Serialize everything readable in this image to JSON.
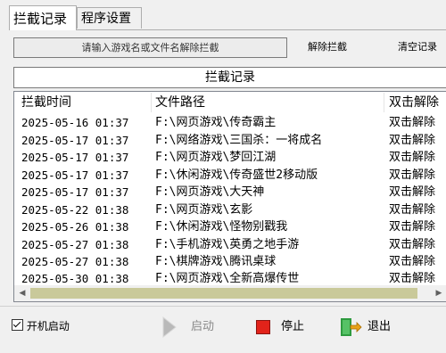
{
  "tabs": [
    {
      "label": "拦截记录",
      "active": true
    },
    {
      "label": "程序设置",
      "active": false
    }
  ],
  "search": {
    "placeholder": "请输入游戏名或文件名解除拦截"
  },
  "actions": {
    "unblock": "解除拦截",
    "clear": "清空记录"
  },
  "section_title": "拦截记录",
  "table": {
    "columns": [
      "拦截时间",
      "文件路径",
      "双击解除"
    ],
    "rows": [
      {
        "time": "2025-05-16 01:37",
        "path": "F:\\网页游戏\\传奇霸主",
        "action": "双击解除"
      },
      {
        "time": "2025-05-17 01:37",
        "path": "F:\\网络游戏\\三国杀：一将成名",
        "action": "双击解除"
      },
      {
        "time": "2025-05-17 01:37",
        "path": "F:\\网页游戏\\梦回江湖",
        "action": "双击解除"
      },
      {
        "time": "2025-05-17 01:37",
        "path": "F:\\休闲游戏\\传奇盛世2移动版",
        "action": "双击解除"
      },
      {
        "time": "2025-05-17 01:37",
        "path": "F:\\网页游戏\\大天神",
        "action": "双击解除"
      },
      {
        "time": "2025-05-22 01:38",
        "path": "F:\\网页游戏\\玄影",
        "action": "双击解除"
      },
      {
        "time": "2025-05-26 01:38",
        "path": "F:\\休闲游戏\\怪物别戳我",
        "action": "双击解除"
      },
      {
        "time": "2025-05-27 01:38",
        "path": "F:\\手机游戏\\英勇之地手游",
        "action": "双击解除"
      },
      {
        "time": "2025-05-27 01:38",
        "path": "F:\\棋牌游戏\\腾讯桌球",
        "action": "双击解除"
      },
      {
        "time": "2025-05-30 01:38",
        "path": "F:\\网页游戏\\全新高爆传世",
        "action": "双击解除"
      }
    ]
  },
  "footer": {
    "autostart_label": "开机启动",
    "autostart_checked": true,
    "start_label": "启动",
    "stop_label": "停止",
    "exit_label": "退出"
  },
  "colors": {
    "stop_icon": "#e2231a",
    "start_icon_disabled": "#b9b9b9",
    "exit_icon": "#2e9b3f",
    "scroll_thumb": "#c9c99a"
  },
  "icons": {
    "start": "play-arrow-icon",
    "stop": "stop-square-icon",
    "exit": "exit-door-icon"
  }
}
